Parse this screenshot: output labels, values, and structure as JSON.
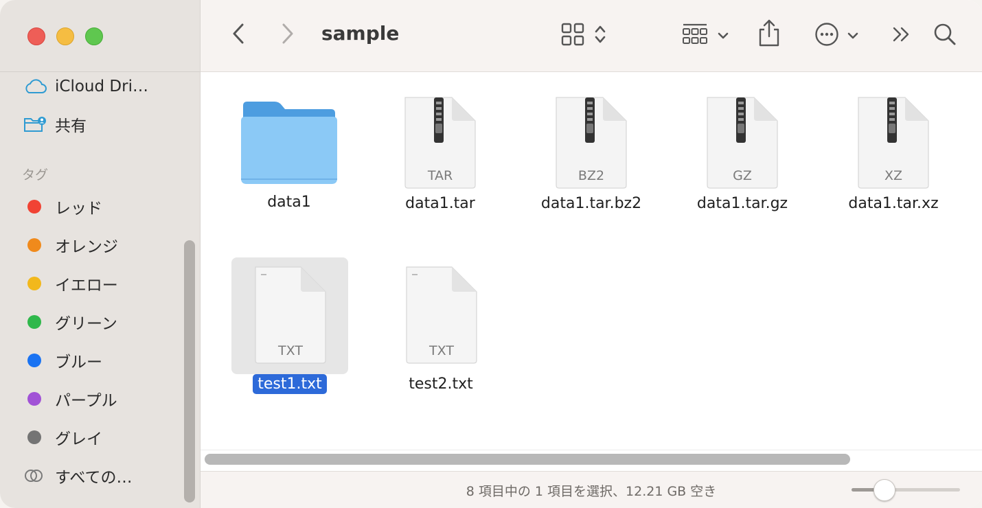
{
  "window": {
    "title": "sample"
  },
  "sidebar": {
    "items": [
      {
        "label": "iCloud Dri…",
        "icon": "cloud-icon"
      },
      {
        "label": "共有",
        "icon": "shared-folder-icon"
      }
    ],
    "tags_heading": "タグ",
    "tags": [
      {
        "label": "レッド",
        "color": "#f14334"
      },
      {
        "label": "オレンジ",
        "color": "#f08a1c"
      },
      {
        "label": "イエロー",
        "color": "#f2b81c"
      },
      {
        "label": "グリーン",
        "color": "#2fb84b"
      },
      {
        "label": "ブルー",
        "color": "#1a73f2"
      },
      {
        "label": "パープル",
        "color": "#a152d6"
      },
      {
        "label": "グレイ",
        "color": "#747474"
      }
    ],
    "all_tags": {
      "label": "すべての…",
      "icon": "all-tags-icon"
    }
  },
  "files": [
    {
      "name": "data1",
      "type": "folder",
      "badge": ""
    },
    {
      "name": "data1.tar",
      "type": "archive",
      "badge": "TAR"
    },
    {
      "name": "data1.tar.bz2",
      "type": "archive",
      "badge": "BZ2"
    },
    {
      "name": "data1.tar.gz",
      "type": "archive",
      "badge": "GZ"
    },
    {
      "name": "data1.tar.xz",
      "type": "archive",
      "badge": "XZ"
    },
    {
      "name": "test1.txt",
      "type": "text",
      "badge": "TXT",
      "selected": true
    },
    {
      "name": "test2.txt",
      "type": "text",
      "badge": "TXT"
    }
  ],
  "status": {
    "text": "8 項目中の 1 項目を選択、12.21 GB 空き"
  }
}
